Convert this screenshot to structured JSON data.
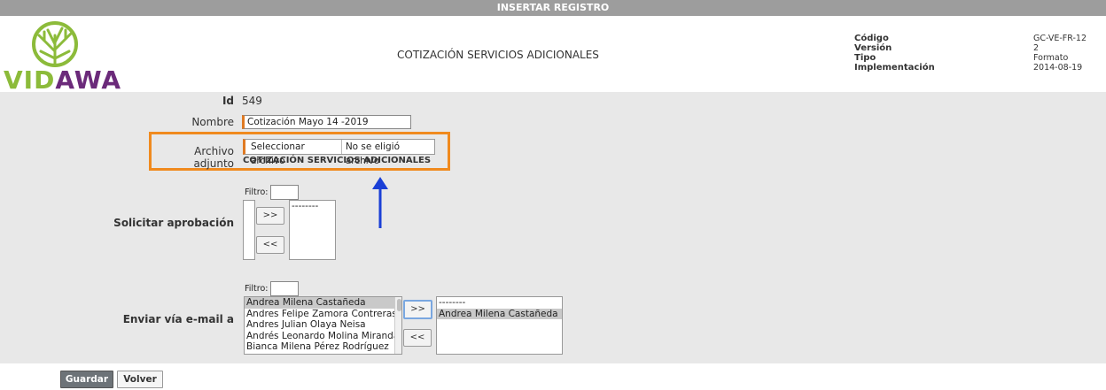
{
  "header": {
    "bar_title": "INSERTAR REGISTRO",
    "logo_text_green": "VID",
    "logo_text_purple": "AWA",
    "doc_title": "COTIZACIÓN SERVICIOS ADICIONALES",
    "meta_labels": [
      "Código",
      "Versión",
      "Tipo",
      "Implementación"
    ],
    "meta_values": [
      "GC-VE-FR-12",
      "2",
      "Formato",
      "2014-08-19"
    ]
  },
  "form": {
    "id_label": "Id",
    "id_value": "549",
    "nombre_label": "Nombre",
    "nombre_value": "Cotización Mayo 14 -2019",
    "archivo_label": "Archivo adjunto",
    "archivo_button": "Seleccionar archivo",
    "archivo_status": "No se eligió archivo",
    "archivo_current": "COTIZACIÓN SERVICIOS ADICIONALES",
    "aprobacion_label": "Solicitar aprobación",
    "aprobacion_filter_label": "Filtro:",
    "aprobacion_selected": [
      "--------"
    ],
    "email_label": "Enviar vía e-mail a",
    "email_filter_label": "Filtro:",
    "email_available": [
      "Andrea Milena Castañeda",
      "Andres Felipe Zamora Contreras",
      "Andres Julian Olaya Neisa",
      "Andrés Leonardo Molina Miranda",
      "Bianca Milena Pérez Rodríguez"
    ],
    "email_selected": [
      "--------",
      "Andrea Milena Castañeda"
    ],
    "add_btn": ">>",
    "remove_btn": "<<"
  },
  "footer": {
    "save_label": "Guardar",
    "back_label": "Volver"
  },
  "colors": {
    "highlight": "#f08a1e",
    "arrow": "#1a3fd6",
    "logo_green": "#8cbb3a",
    "logo_purple": "#6b2a7a"
  }
}
